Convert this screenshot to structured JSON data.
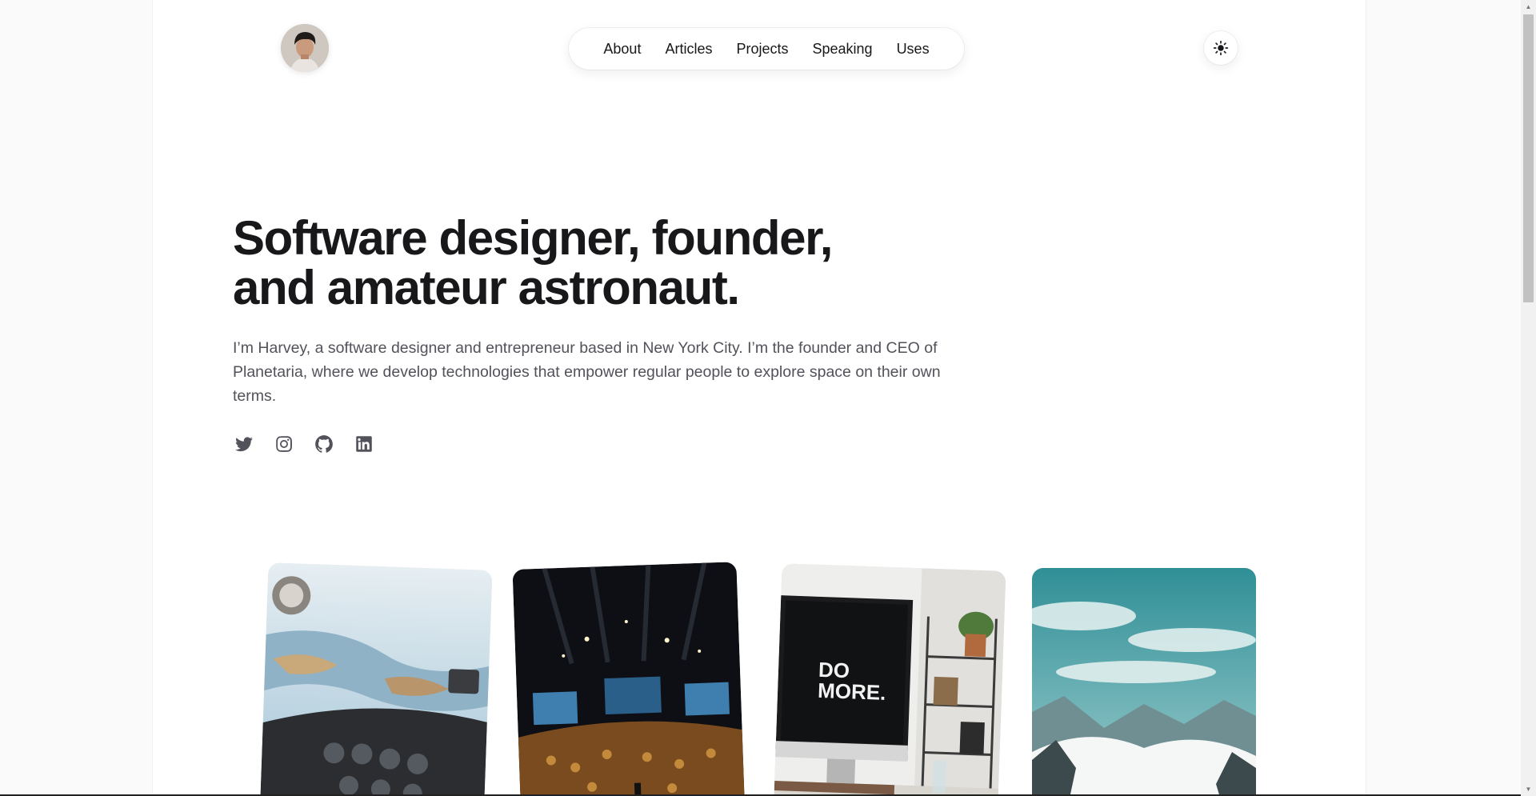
{
  "nav": {
    "items": [
      {
        "label": "About"
      },
      {
        "label": "Articles"
      },
      {
        "label": "Projects"
      },
      {
        "label": "Speaking"
      },
      {
        "label": "Uses"
      }
    ]
  },
  "theme_toggle": {
    "icon": "sun-icon"
  },
  "hero": {
    "title_line1": "Software designer, founder,",
    "title_line2": "and amateur astronaut.",
    "paragraph": "I’m Harvey, a software designer and entrepreneur based in New York City. I’m the founder and CEO of Planetaria, where we develop technologies that empower regular people to explore space on their own terms."
  },
  "socials": [
    {
      "icon": "twitter-icon"
    },
    {
      "icon": "instagram-icon"
    },
    {
      "icon": "github-icon"
    },
    {
      "icon": "linkedin-icon"
    }
  ],
  "photos": [
    {
      "subject": "airplane cockpit over islands"
    },
    {
      "subject": "conference audience and stage"
    },
    {
      "subject": "desk with monitor reading DO MORE."
    },
    {
      "subject": "mountains above clouds"
    }
  ],
  "photo_text": {
    "monitor_line1": "DO",
    "monitor_line2": "MORE."
  },
  "colors": {
    "text": "#18181b",
    "muted": "#52525b",
    "background": "#fafafa"
  }
}
